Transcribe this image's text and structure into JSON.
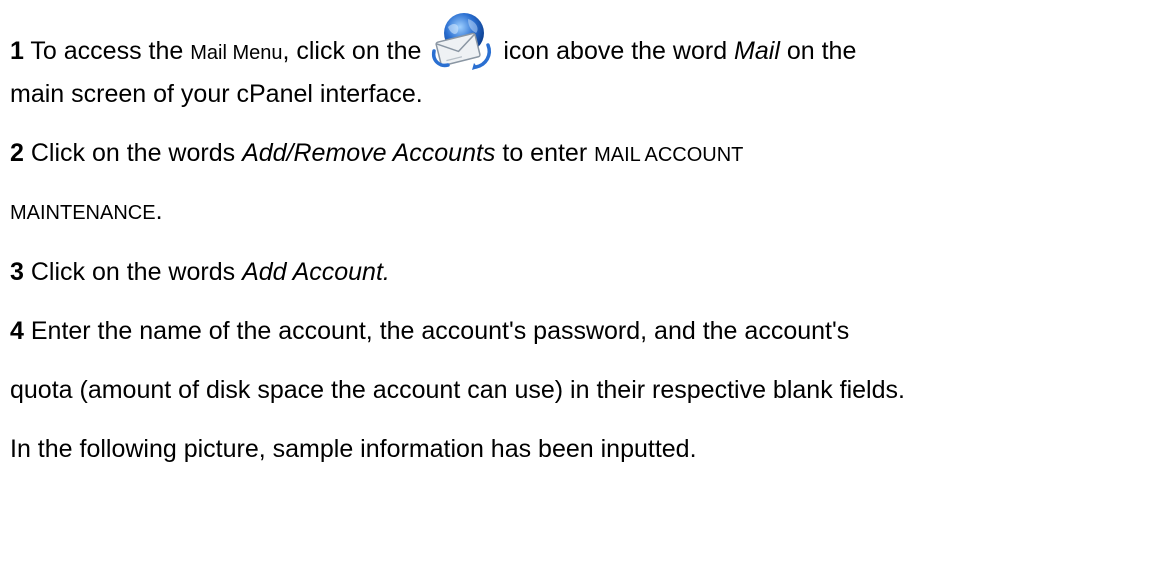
{
  "steps": [
    {
      "number": "1",
      "lines": [
        {
          "pre": "To access the ",
          "mail_menu": "Mail Menu",
          "mid": ", click on the ",
          "post_icon": " icon above the word ",
          "mail_word": "Mail",
          "end": " on the"
        },
        {
          "text": "main screen of your cPanel interface."
        }
      ]
    },
    {
      "number": "2",
      "lines": [
        {
          "pre": "Click on the words ",
          "emph": "Add/Remove Accounts",
          "mid": " to enter ",
          "caps": "MAIL ACCOUNT"
        },
        {
          "caps": "MAINTENANCE",
          "end": "."
        }
      ]
    },
    {
      "number": "3",
      "lines": [
        {
          "pre": "Click on the words ",
          "emph": "Add Account."
        }
      ]
    },
    {
      "number": "4",
      "lines": [
        {
          "text": "Enter the name of the account, the account's password, and the account's"
        },
        {
          "text": "quota (amount of disk space the account can use) in their respective blank fields."
        },
        {
          "text": "In the following picture, sample information has been inputted."
        }
      ]
    }
  ],
  "icons": {
    "mail_icon": "mail-globe-icon"
  },
  "colors": {
    "text": "#000000",
    "background": "#ffffff",
    "globe_blue": "#2a6fd1",
    "envelope": "#e9ecef"
  }
}
